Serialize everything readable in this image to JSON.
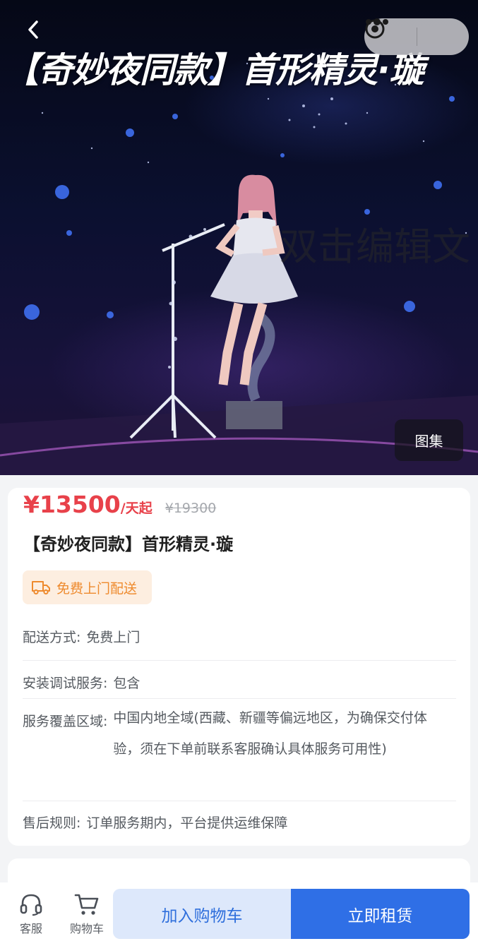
{
  "hero": {
    "overlay_title": "【奇妙夜同款】首形精灵·璇",
    "watermark_text": "双击编辑文",
    "gallery_label": "图集"
  },
  "nav": {
    "back_icon": "chevron-left-icon",
    "more_icon": "more-dots-icon",
    "close_icon": "target-circle-icon"
  },
  "product": {
    "price": "¥13500",
    "price_unit": "/天起",
    "original_price": "¥19300",
    "title": "【奇妙夜同款】首形精灵·璇",
    "badge": {
      "icon": "delivery-truck-icon",
      "label": "免费上门配送",
      "color": "#ee8a2d"
    },
    "specs": [
      {
        "label": "配送方式:",
        "value": "免费上门"
      },
      {
        "label": "安装调试服务:",
        "value": "包含"
      },
      {
        "label": "服务覆盖区域:",
        "value": "中国内地全域(西藏、新疆等偏远地区，为确保交付体验，须在下单前联系客服确认具体服务可用性)"
      },
      {
        "label": "售后规则:",
        "value": "订单服务期内，平台提供运维保障"
      }
    ]
  },
  "bottom_bar": {
    "service": {
      "icon": "headset-icon",
      "label": "客服"
    },
    "cart": {
      "icon": "shopping-cart-icon",
      "label": "购物车"
    },
    "add_to_cart_label": "加入购物车",
    "rent_now_label": "立即租赁"
  },
  "colors": {
    "price": "#e8414a",
    "primary": "#2f6fe6",
    "primary_light": "#dde8fb"
  }
}
